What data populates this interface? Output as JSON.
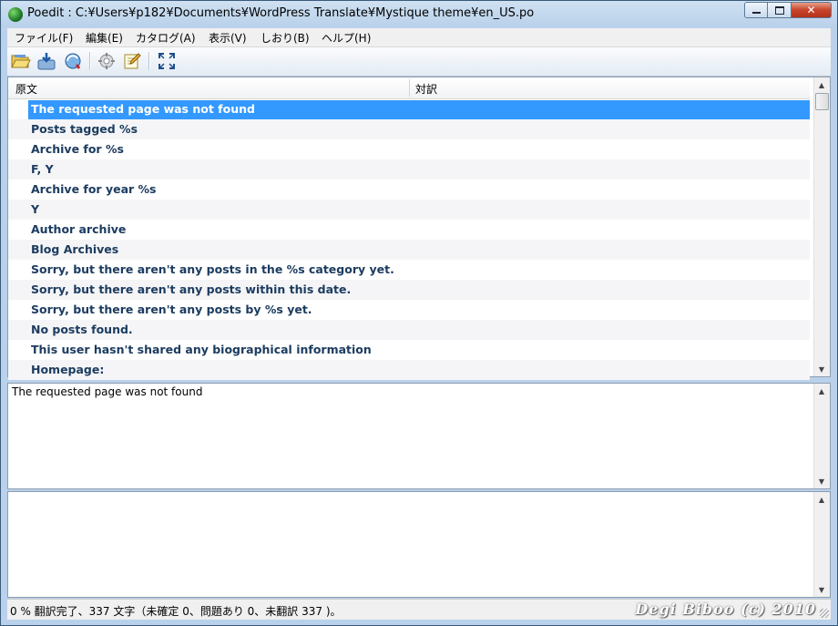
{
  "window": {
    "title": "Poedit : C:¥Users¥p182¥Documents¥WordPress Translate¥Mystique theme¥en_US.po"
  },
  "menu": [
    {
      "label": "ファイル(F)"
    },
    {
      "label": "編集(E)"
    },
    {
      "label": "カタログ(A)"
    },
    {
      "label": "表示(V)"
    },
    {
      "label": "しおり(B)"
    },
    {
      "label": "ヘルプ(H)"
    }
  ],
  "toolbar": {
    "icons": [
      "open-folder-icon",
      "save-icon",
      "update-catalog-icon",
      "validate-icon",
      "comment-edit-icon",
      "fullscreen-icon"
    ]
  },
  "list": {
    "col_source": "原文",
    "col_translation": "対訳",
    "rows": [
      {
        "source": "The requested page was not found",
        "translation": "",
        "selected": true
      },
      {
        "source": "Posts tagged %s",
        "translation": ""
      },
      {
        "source": "Archive for %s",
        "translation": ""
      },
      {
        "source": "F, Y",
        "translation": ""
      },
      {
        "source": "Archive for year %s",
        "translation": ""
      },
      {
        "source": "Y",
        "translation": ""
      },
      {
        "source": "Author archive",
        "translation": ""
      },
      {
        "source": "Blog Archives",
        "translation": ""
      },
      {
        "source": "Sorry, but there aren't any posts in the %s category yet.",
        "translation": ""
      },
      {
        "source": "Sorry, but there aren't any posts within this date.",
        "translation": ""
      },
      {
        "source": "Sorry, but there aren't any posts by %s yet.",
        "translation": ""
      },
      {
        "source": "No posts found.",
        "translation": ""
      },
      {
        "source": "This user hasn't shared any biographical information",
        "translation": ""
      },
      {
        "source": "Homepage:",
        "translation": ""
      }
    ]
  },
  "source_pane": {
    "text": "The requested page was not found"
  },
  "translation_pane": {
    "text": ""
  },
  "status": {
    "text": "0 % 翻訳完了、337 文字（未確定 0、問題あり 0、未翻訳 337 )。",
    "watermark": "Degi Biboo (c) 2010"
  },
  "colors": {
    "selection": "#3399ff",
    "source_text": "#1c3c60"
  }
}
